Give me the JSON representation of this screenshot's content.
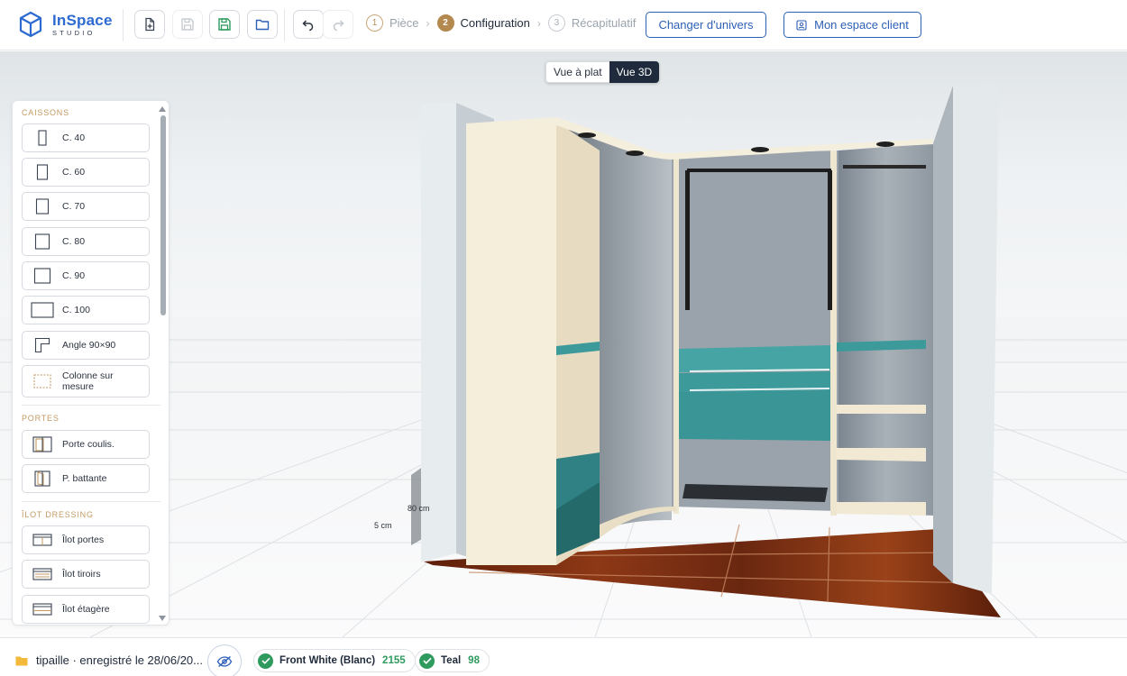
{
  "app": {
    "logo_title": "InSpace",
    "logo_subtitle": "STUDIO"
  },
  "toolbar": {
    "new_project_icon": "file-plus-icon",
    "save_icon": "save-icon",
    "save_as_icon": "save-green-icon",
    "open_icon": "folder-open-icon",
    "undo_icon": "undo-icon",
    "redo_icon": "redo-icon"
  },
  "steps": [
    {
      "num": "1",
      "label": "Pièce"
    },
    {
      "num": "2",
      "label": "Configuration"
    },
    {
      "num": "3",
      "label": "Récapitulatif"
    }
  ],
  "header_buttons": {
    "change_universe": "Changer d'univers",
    "client_space": "Mon espace client"
  },
  "view_toggle": {
    "flat": "Vue à plat",
    "three_d": "Vue 3D",
    "selected": "Vue 3D"
  },
  "panel": {
    "sections": [
      {
        "title": "CAISSONS"
      },
      {
        "title": "PORTES"
      },
      {
        "title": "ÎLOT DRESSING"
      }
    ],
    "caissons": [
      {
        "label": "C. 40",
        "icon": "cabinet-40-icon"
      },
      {
        "label": "C. 60",
        "icon": "cabinet-60-icon"
      },
      {
        "label": "C. 70",
        "icon": "cabinet-70-icon"
      },
      {
        "label": "C. 80",
        "icon": "cabinet-80-icon"
      },
      {
        "label": "C. 90",
        "icon": "cabinet-90-icon"
      },
      {
        "label": "C. 100",
        "icon": "cabinet-100-icon"
      },
      {
        "label": "Angle 90×90",
        "icon": "corner-angle-icon"
      },
      {
        "label": "Colonne sur mesure",
        "icon": "custom-column-icon"
      }
    ],
    "portes": [
      {
        "label": "Porte coulis.",
        "icon": "sliding-door-icon"
      },
      {
        "label": "P. battante",
        "icon": "hinged-door-icon"
      }
    ],
    "ilot": [
      {
        "label": "Îlot portes",
        "icon": "island-doors-icon"
      },
      {
        "label": "Îlot tiroirs",
        "icon": "island-drawers-icon"
      },
      {
        "label": "Îlot étagère",
        "icon": "island-shelf-icon"
      }
    ]
  },
  "scene": {
    "dim_depth": "80 cm",
    "dim_gap": "5 cm",
    "colors": {
      "wall": "#d7dee3",
      "cabinet_panel": "#f3ecd9",
      "teal_accent": "#3c9a9b",
      "floor_wood": "#7a2f14"
    }
  },
  "footer": {
    "project": "tipaille · enregistré le 28/06/20...",
    "visibility_icon": "eye-off-icon",
    "materials": [
      {
        "name": "Front White (Blanc)",
        "count": "2155"
      },
      {
        "name": "Teal",
        "count": "98"
      }
    ]
  },
  "theme": {
    "brand_blue": "#2d5fb7",
    "accent_gold": "#b3894f",
    "success_green": "#2e9a5e"
  }
}
